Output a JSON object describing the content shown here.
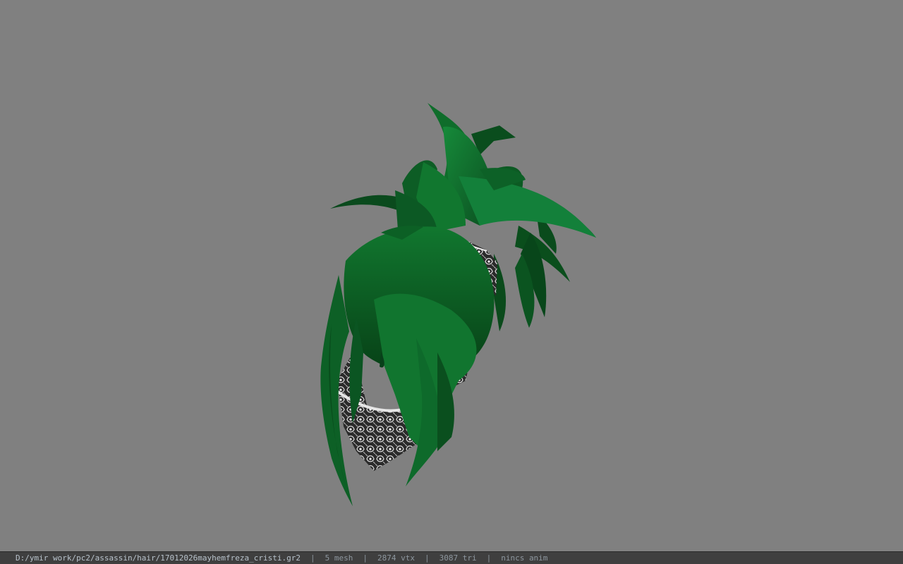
{
  "viewport": {
    "background": "#808080",
    "model_icon": "hair-mesh-3d-model",
    "hair_color": "#0f6a2c",
    "bandana_pattern": "paisley"
  },
  "status_bar": {
    "file_path": "D:/ymir work/pc2/assassin/hair/17012026mayhemfreza_cristi.gr2",
    "separator": "|",
    "mesh_count": "5 mesh",
    "vertex_count": "2874 vtx",
    "triangle_count": "3087 tri",
    "anim_status": "nincs anim"
  }
}
